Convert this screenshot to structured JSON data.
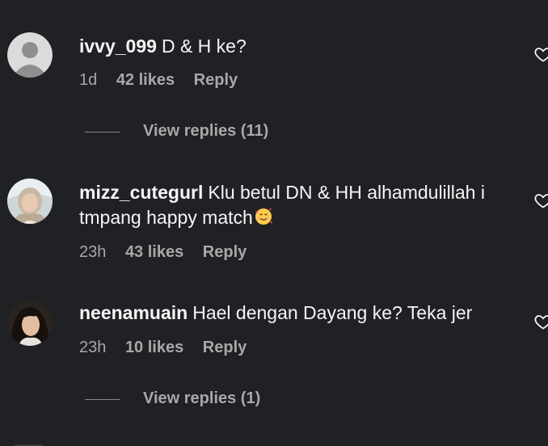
{
  "comments": [
    {
      "username": "ivvy_099",
      "text": "D & H ke?",
      "age": "1d",
      "likes": "42 likes",
      "reply": "Reply",
      "view_replies": "View replies (11)",
      "avatar": "default-avatar-icon"
    },
    {
      "username": "mizz_cutegurl",
      "text": "Klu betul DN & HH alhamdulillah i tmpang happy match",
      "emoji": "smiling-face-with-hearts-emoji",
      "age": "23h",
      "likes": "43 likes",
      "reply": "Reply",
      "avatar": "profile-photo"
    },
    {
      "username": "neenamuain",
      "text": "Hael dengan Dayang ke? Teka jer",
      "age": "23h",
      "likes": "10 likes",
      "reply": "Reply",
      "view_replies": "View replies (1)",
      "avatar": "profile-photo"
    }
  ],
  "colors": {
    "background": "#1f2125",
    "primary_text": "#f5f5f5",
    "secondary_text": "#a8a8a8"
  }
}
